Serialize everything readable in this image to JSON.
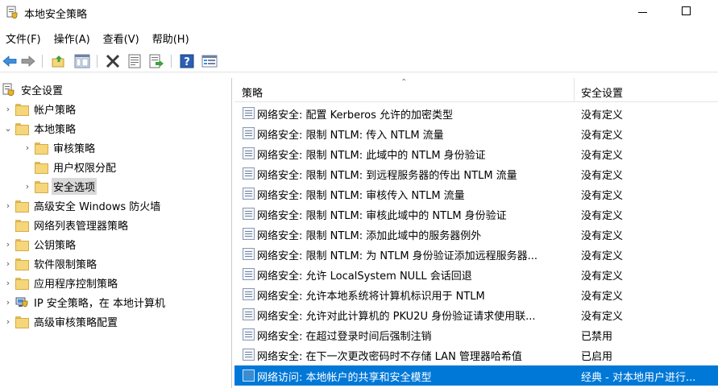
{
  "window": {
    "title": "本地安全策略"
  },
  "menu": [
    "文件(F)",
    "操作(A)",
    "查看(V)",
    "帮助(H)"
  ],
  "toolbar": {
    "icons": [
      "back-arrow-icon",
      "forward-arrow-icon",
      "up-folder-icon",
      "show-hide-tree-icon",
      "delete-icon",
      "properties-icon",
      "export-list-icon",
      "help-icon",
      "details-view-icon"
    ]
  },
  "tree": {
    "items": [
      {
        "label": "安全设置",
        "level": 0,
        "expander": "",
        "icon": "security-settings-icon"
      },
      {
        "label": "帐户策略",
        "level": 1,
        "expander": "›",
        "icon": "folder-icon"
      },
      {
        "label": "本地策略",
        "level": 1,
        "expander": "⌄",
        "icon": "folder-icon"
      },
      {
        "label": "审核策略",
        "level": 2,
        "expander": "›",
        "icon": "folder-icon"
      },
      {
        "label": "用户权限分配",
        "level": 2,
        "expander": "",
        "icon": "folder-icon"
      },
      {
        "label": "安全选项",
        "level": 2,
        "expander": "›",
        "icon": "folder-icon",
        "selected": true
      },
      {
        "label": "高级安全 Windows 防火墙",
        "level": 1,
        "expander": "›",
        "icon": "folder-icon"
      },
      {
        "label": "网络列表管理器策略",
        "level": 1,
        "expander": "",
        "icon": "folder-icon"
      },
      {
        "label": "公钥策略",
        "level": 1,
        "expander": "›",
        "icon": "folder-icon"
      },
      {
        "label": "软件限制策略",
        "level": 1,
        "expander": "›",
        "icon": "folder-icon"
      },
      {
        "label": "应用程序控制策略",
        "level": 1,
        "expander": "›",
        "icon": "folder-icon"
      },
      {
        "label": "IP 安全策略，在 本地计算机",
        "level": 1,
        "expander": "›",
        "icon": "ip-security-icon"
      },
      {
        "label": "高级审核策略配置",
        "level": 1,
        "expander": "›",
        "icon": "folder-icon"
      }
    ]
  },
  "list": {
    "headers": {
      "policy": "策略",
      "setting": "安全设置"
    },
    "rows": [
      {
        "policy": "网络安全: 配置 Kerberos 允许的加密类型",
        "setting": "没有定义"
      },
      {
        "policy": "网络安全: 限制 NTLM: 传入 NTLM 流量",
        "setting": "没有定义"
      },
      {
        "policy": "网络安全: 限制 NTLM: 此域中的 NTLM 身份验证",
        "setting": "没有定义"
      },
      {
        "policy": "网络安全: 限制 NTLM: 到远程服务器的传出 NTLM 流量",
        "setting": "没有定义"
      },
      {
        "policy": "网络安全: 限制 NTLM: 审核传入 NTLM 流量",
        "setting": "没有定义"
      },
      {
        "policy": "网络安全: 限制 NTLM: 审核此域中的 NTLM 身份验证",
        "setting": "没有定义"
      },
      {
        "policy": "网络安全: 限制 NTLM: 添加此域中的服务器例外",
        "setting": "没有定义"
      },
      {
        "policy": "网络安全: 限制 NTLM: 为 NTLM 身份验证添加远程服务器...",
        "setting": "没有定义"
      },
      {
        "policy": "网络安全: 允许 LocalSystem NULL 会话回退",
        "setting": "没有定义"
      },
      {
        "policy": "网络安全: 允许本地系统将计算机标识用于 NTLM",
        "setting": "没有定义"
      },
      {
        "policy": "网络安全: 允许对此计算机的 PKU2U 身份验证请求使用联...",
        "setting": "没有定义"
      },
      {
        "policy": "网络安全: 在超过登录时间后强制注销",
        "setting": "已禁用"
      },
      {
        "policy": "网络安全: 在下一次更改密码时不存储 LAN 管理器哈希值",
        "setting": "已启用"
      },
      {
        "policy": "网络访问: 本地帐户的共享和安全模型",
        "setting": "经典 - 对本地用户进行...",
        "selected": true
      }
    ]
  }
}
